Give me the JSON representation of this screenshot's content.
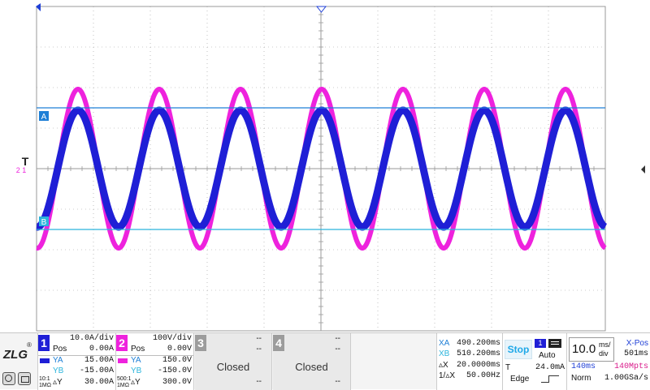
{
  "brand": {
    "logo_text": "ZLG"
  },
  "trace_colors": {
    "ch1": "#1f1fd6",
    "ch2": "#ee22dd",
    "cursor_a": "#1e7fd6",
    "cursor_b": "#2ab4dc",
    "grid": "#9a9a9a"
  },
  "markers": {
    "cursor_a": "A",
    "cursor_b": "B",
    "trigger": "T",
    "ch_ref": "2 1"
  },
  "ch1": {
    "number": "1",
    "scale": "10.0A/div",
    "pos_label": "Pos",
    "pos": "0.00A",
    "ya_label": "YA",
    "ya": "15.00A",
    "yb_label": "YB",
    "yb": "-15.00A",
    "probe": "10:1",
    "impedance": "1MΩ",
    "dy_label": "▵Y",
    "dy": "30.00A"
  },
  "ch2": {
    "number": "2",
    "scale": "100V/div",
    "pos_label": "Pos",
    "pos": "0.00V",
    "ya_label": "YA",
    "ya": "150.0V",
    "yb_label": "YB",
    "yb": "-150.0V",
    "probe": "500:1",
    "impedance": "1MΩ",
    "dy_label": "▵Y",
    "dy": "300.0V"
  },
  "ch3": {
    "number": "3",
    "status": "Closed",
    "dash": "--"
  },
  "ch4": {
    "number": "4",
    "status": "Closed",
    "dash": "--"
  },
  "cursors": {
    "xa_label": "XA",
    "xa": "490.200ms",
    "xb_label": "XB",
    "xb": "510.200ms",
    "dx_label": "▵X",
    "dx": "20.0000ms",
    "freq_label": "1/▵X",
    "freq": "50.00Hz"
  },
  "trigger": {
    "state": "Stop",
    "source": "1",
    "mode": "Auto",
    "type_label": "T",
    "level": "24.0mA",
    "type": "Edge"
  },
  "timebase": {
    "value": "10.0",
    "unit_top": "ms/",
    "unit_bottom": "div",
    "xpos_label": "X-Pos",
    "xpos": "501ms",
    "window": "140ms",
    "memory": "140Mpts",
    "acq_mode": "Norm",
    "sample_rate": "1.00GSa/s"
  },
  "waveform": {
    "ch1_amplitude_A": 15.0,
    "ch2_amplitude_V": 200.0,
    "frequency_hz": 50,
    "periods_shown": 7
  }
}
